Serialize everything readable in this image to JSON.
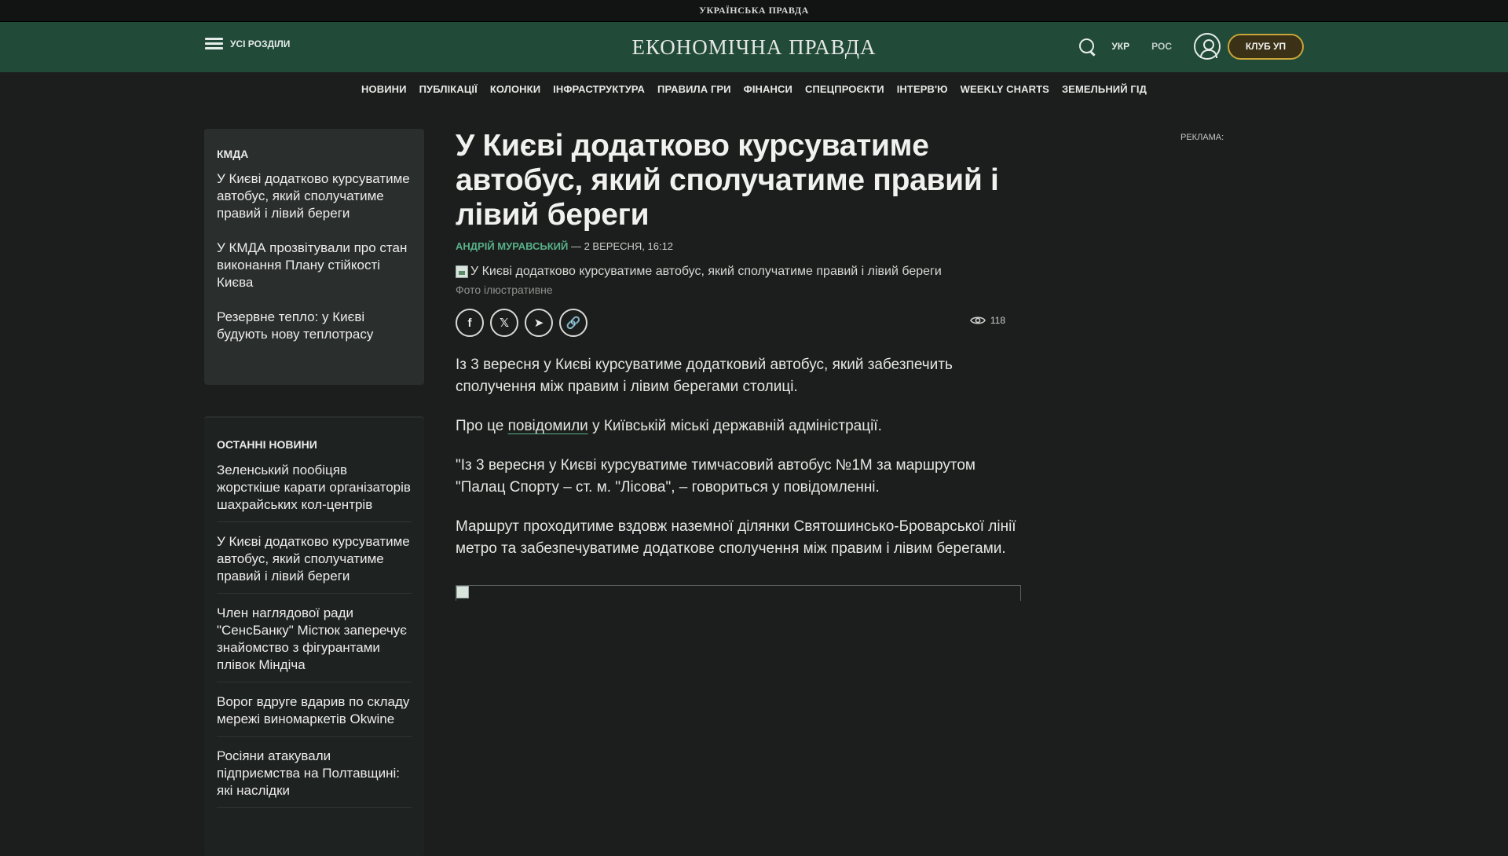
{
  "site": {
    "top_brand": "УКРАЇНСЬКА ПРАВДА",
    "logo": "ЕКОНОМІЧНА ПРАВДА"
  },
  "header": {
    "menu_label": "УСІ РОЗДІЛИ",
    "lang_active": "УКР",
    "lang_alt": "РОС",
    "club_label": "КЛУБ УП"
  },
  "nav": [
    "НОВИНИ",
    "ПУБЛІКАЦІЇ",
    "КОЛОНКИ",
    "ІНФРАСТРУКТУРА",
    "ПРАВИЛА ГРИ",
    "ФІНАНСИ",
    "СПЕЦПРОЄКТИ",
    "ІНТЕРВ'Ю",
    "WEEKLY CHARTS",
    "ЗЕМЕЛЬНИЙ ГІД"
  ],
  "tag_block": {
    "title": "КМДА",
    "items": [
      "У Києві додатково курсуватиме автобус, який сполучатиме правий і лівий береги",
      "У КМДА прозвітували про стан виконання Плану стійкості Києва",
      "Резервне тепло: у Києві будують нову теплотрасу"
    ]
  },
  "latest": {
    "title": "ОСТАННІ НОВИНИ",
    "items": [
      "Зеленський пообіцяв жорсткіше карати організаторів шахрайських кол-центрів",
      "У Києві додатково курсуватиме автобус, який сполучатиме правий і лівий береги",
      "Член наглядової ради \"СенсБанку\" Містюк заперечує знайомство з фігурантами плівок Міндіча",
      "Ворог вдруге вдарив по складу мережі виномаркетів Okwine",
      "Росіяни атакували підприємства на Полтавщині: які наслідки"
    ]
  },
  "article": {
    "title": "У Києві додатково курсуватиме автобус, який сполучатиме правий і лівий береги",
    "author": "АНДРІЙ МУРАВСЬКИЙ",
    "date": " — 2 ВЕРЕСНЯ, 16:12",
    "image_alt": "У Києві додатково курсуватиме автобус, який сполучатиме правий і лівий береги",
    "caption": "Фото ілюстративне",
    "views": "118",
    "p1": "Із 3 вересня у Києві курсуватиме додатковий автобус, який забезпечить сполучення між правим і лівим берегами столиці.",
    "p2_before": "Про це ",
    "p2_link": "повідомили",
    "p2_after": " у Київській міські державній адміністрації.",
    "p3": "\"Із 3 вересня у Києві курсуватиме тимчасовий автобус №1М за маршрутом \"Палац Спорту – ст. м. \"Лісова\", – говориться у повідомленні.",
    "p4": "Маршрут проходитиме вздовж наземної ділянки Святошинсько-Броварської лінії метро та забезпечуватиме додаткове сполучення між правим і лівим берегами."
  },
  "share": {
    "facebook": "f",
    "x": "𝕏",
    "telegram": "➤",
    "link": "🔗"
  },
  "ad": {
    "label": "РЕКЛАМА:"
  },
  "colors": {
    "header_bg": "#214a39",
    "accent": "#58b08a",
    "club_border": "#c8a537",
    "page_bg": "#1b1e1c"
  }
}
